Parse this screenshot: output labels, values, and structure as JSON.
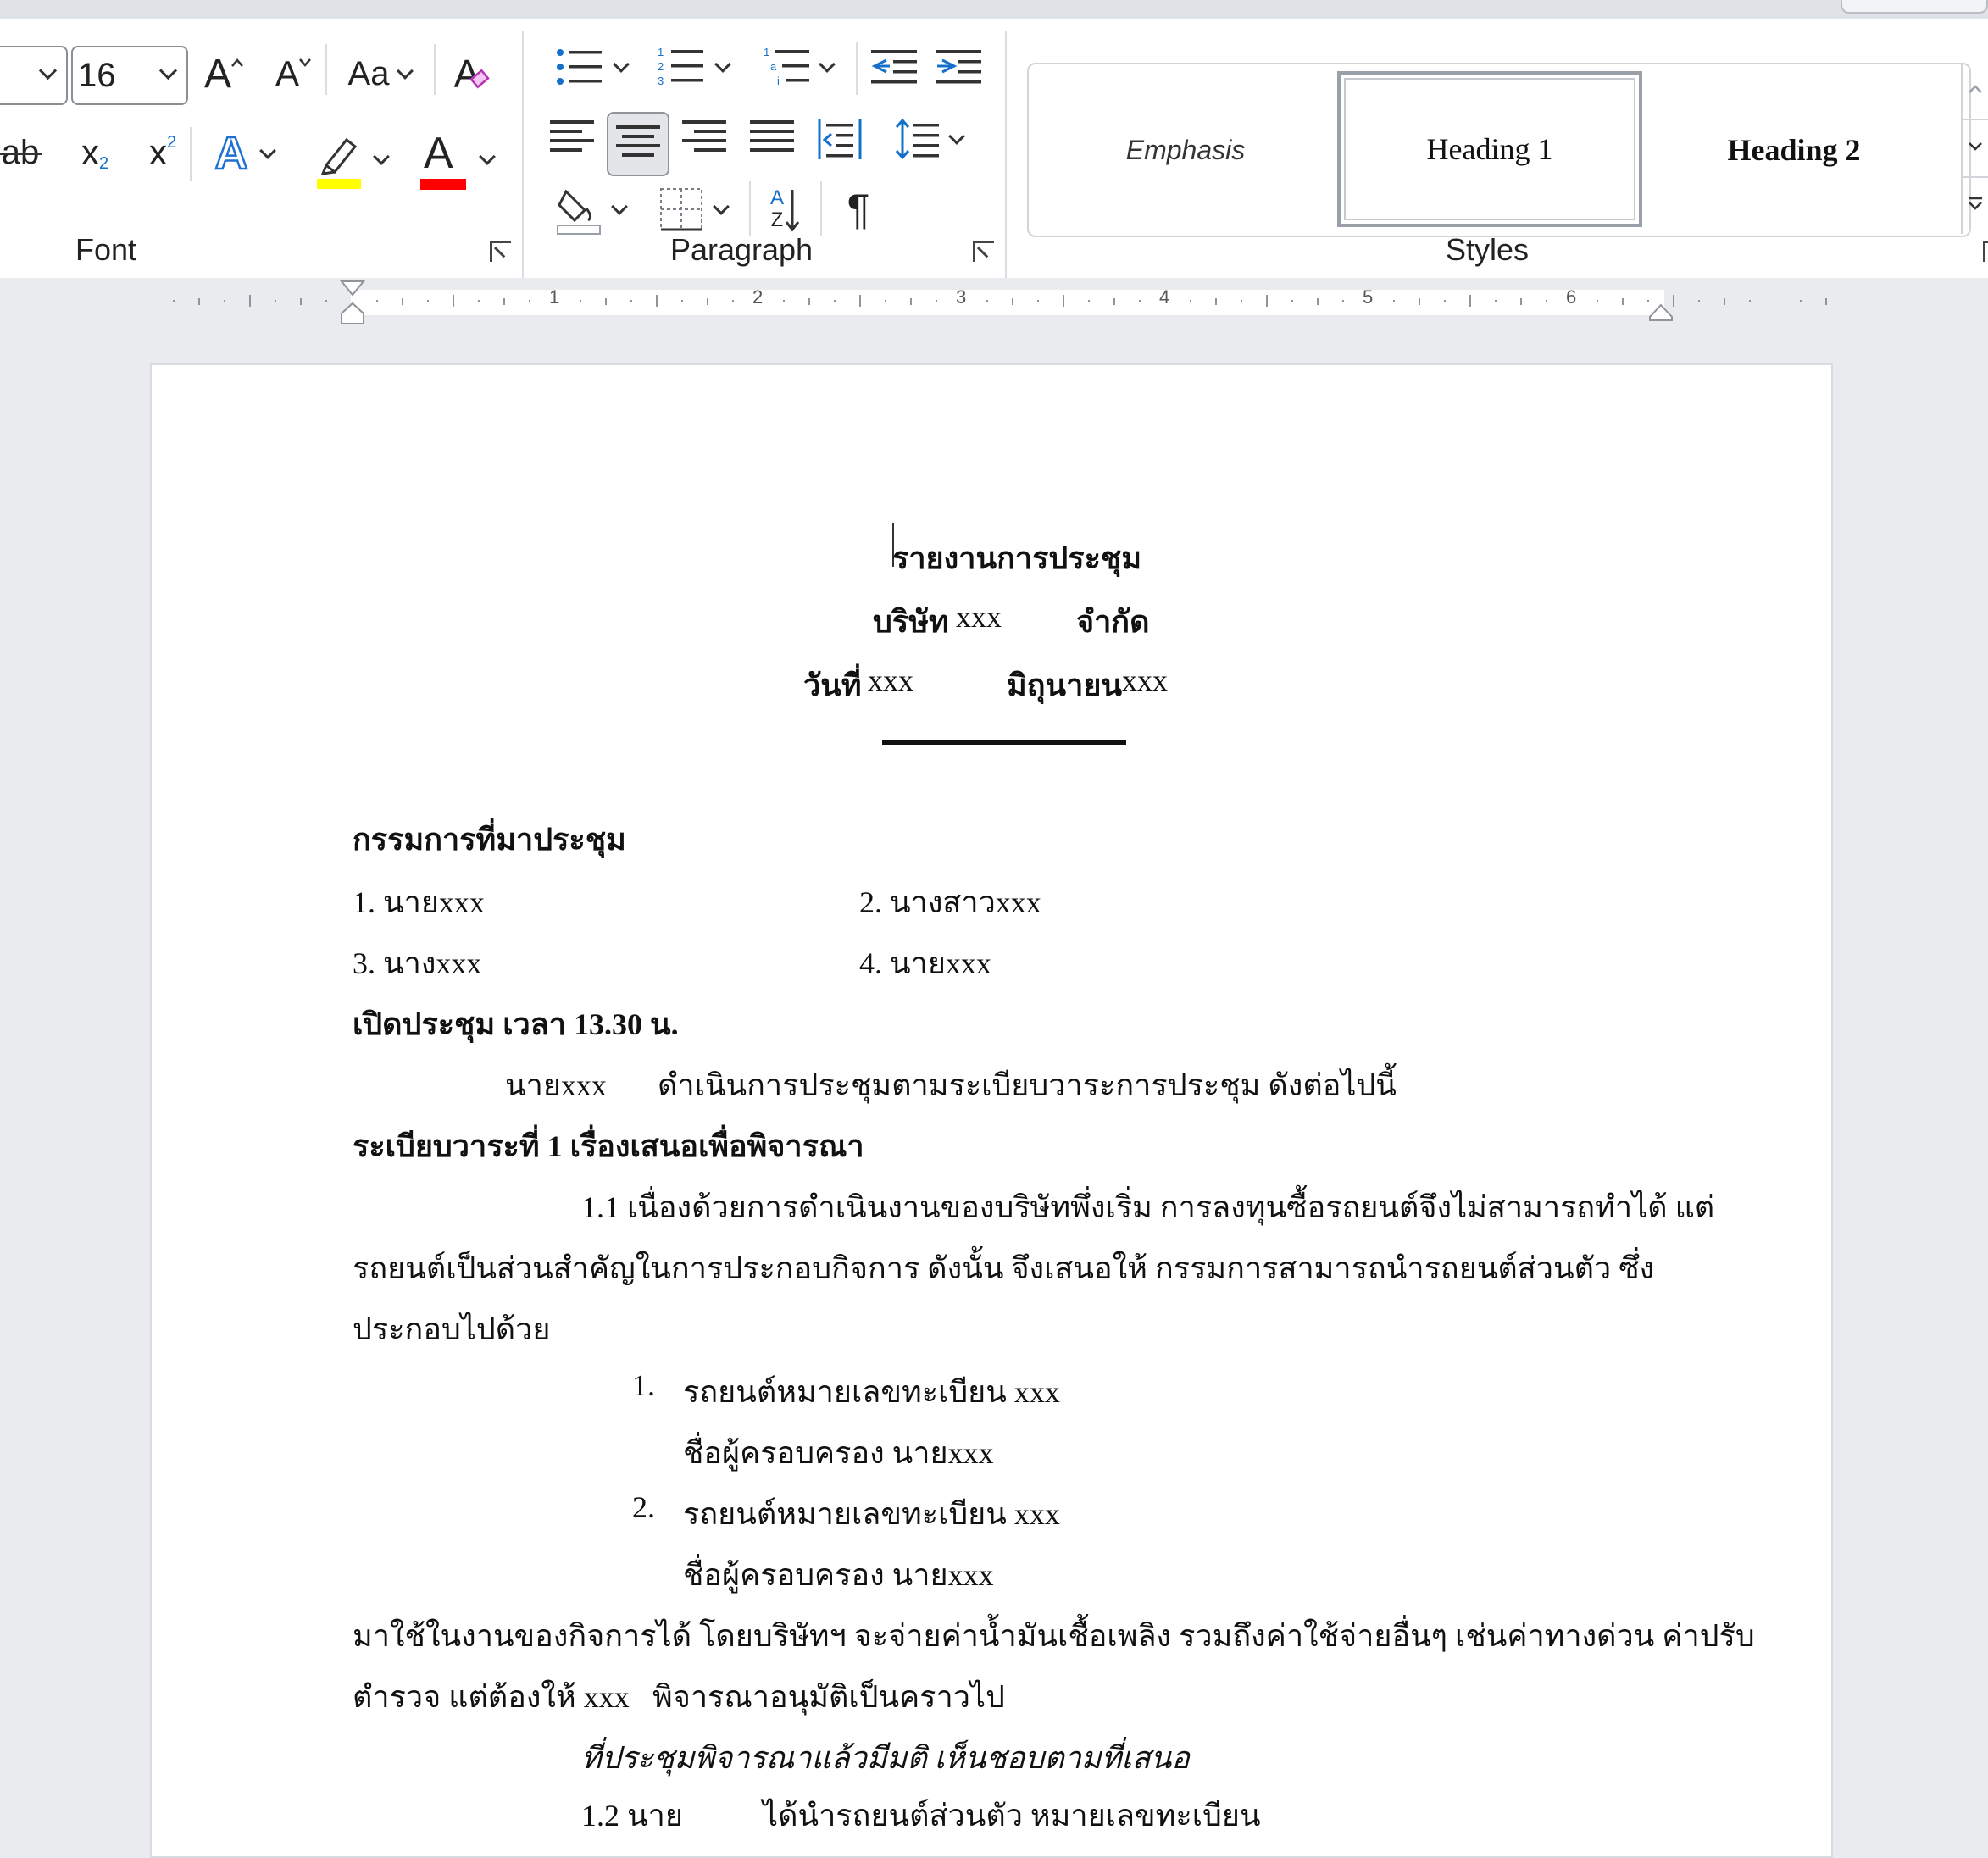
{
  "ribbon": {
    "font": {
      "size_value": "16",
      "grow_label": "A",
      "shrink_label": "A",
      "case_label": "Aa",
      "clear_label": "A",
      "strike_label": "ab",
      "sub_label": "x",
      "sub_mark": "2",
      "sup_label": "x",
      "sup_mark": "2",
      "effects_label": "A",
      "fontcolor_label": "A",
      "group_label": "Font",
      "highlight_color": "#ffff00",
      "font_color": "#ff0000"
    },
    "paragraph": {
      "group_label": "Paragraph",
      "pilcrow": "¶",
      "sort_a": "A",
      "sort_z": "Z"
    },
    "styles": {
      "group_label": "Styles",
      "items": [
        "Emphasis",
        "Heading 1",
        "Heading 2"
      ]
    }
  },
  "ruler": {
    "numbers": [
      "1",
      "2",
      "3",
      "4",
      "5",
      "6"
    ]
  },
  "document": {
    "title": "รายงานการประชุม",
    "company_a": "บริษัท",
    "company_b": "xxx",
    "company_c": "จำกัด",
    "date_a": "วันที่",
    "date_b": "xxx",
    "date_c": "มิถุนายน",
    "date_d": "xxx",
    "attendees_heading": "กรรมการที่มาประชุม",
    "attendee_1": "1. นายxxx",
    "attendee_2": "2. นางสาวxxx",
    "attendee_3": "3. นางxxx",
    "attendee_4": "4. นายxxx",
    "opening": "เปิดประชุม  เวลา  13.30  น.",
    "chair_name": "นายxxx",
    "chair_text": "ดำเนินการประชุมตามระเบียบวาระการประชุม ดังต่อไปนี้",
    "agenda_1": "ระเบียบวาระที่  1  เรื่องเสนอเพื่อพิจารณา",
    "p1_line1": "1.1 เนื่องด้วยการดำเนินงานของบริษัทพึ่งเริ่ม การลงทุนซื้อรถยนต์จึงไม่สามารถทำได้ แต่",
    "p1_line2": "รถยนต์เป็นส่วนสำคัญในการประกอบกิจการ ดังนั้น จึงเสนอให้ กรรมการสามารถนำรถยนต์ส่วนตัว ซึ่ง",
    "p1_line3": "ประกอบไปด้วย",
    "list_num_1": "1.",
    "list_item_1": "รถยนต์หมายเลขทะเบียน xxx",
    "list_owner_1": "ชื่อผู้ครอบครอง นายxxx",
    "list_num_2": "2.",
    "list_item_2": "รถยนต์หมายเลขทะเบียน xxx",
    "list_owner_2": "ชื่อผู้ครอบครอง นายxxx",
    "p2_line1": "มาใช้ในงานของกิจการได้ โดยบริษัทฯ จะจ่ายค่าน้ำมันเชื้อเพลิง รวมถึงค่าใช้จ่ายอื่นๆ เช่นค่าทางด่วน ค่าปรับ",
    "p2_line2a": "ตำรวจ แต่ต้องให้ xxx",
    "p2_line2b": "พิจารณาอนุมัติเป็นคราวไป",
    "resolution": "ที่ประชุมพิจารณาแล้วมีมติ  เห็นชอบตามที่เสนอ",
    "p3_partial_a": "1.2 นาย",
    "p3_partial_b": "ได้นำรถยนต์ส่วนตัว หมายเลขทะเบียน"
  }
}
